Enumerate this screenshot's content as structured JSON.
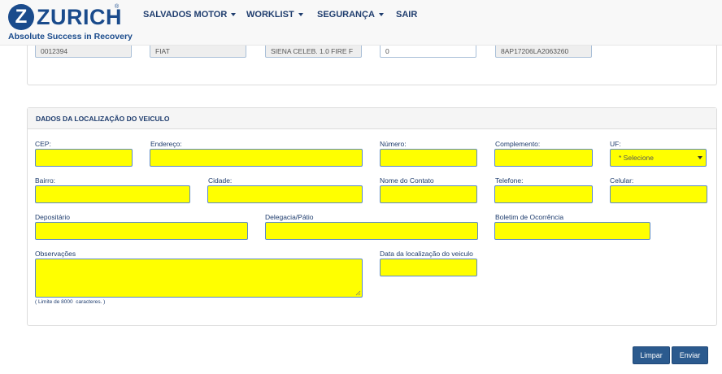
{
  "header": {
    "logo_letter": "Z",
    "brand": "ZURICH",
    "registered": "®",
    "tagline": "Absolute Success in Recovery",
    "nav": [
      {
        "label": "SALVADOS MOTOR"
      },
      {
        "label": "WORKLIST"
      },
      {
        "label": "SEGURANÇA"
      },
      {
        "label": "SAIR"
      }
    ]
  },
  "vehicle_row": {
    "values": [
      "0012394",
      "FIAT",
      "SIENA CELEB. 1.0 FIRE F",
      "0",
      "8AP17206LA2063260"
    ]
  },
  "location": {
    "title": "DADOS DA LOCALIZAÇÃO DO VEICULO",
    "labels": {
      "cep": "CEP:",
      "endereco": "Endereço:",
      "numero": "Número:",
      "complemento": "Complemento:",
      "uf": "UF:",
      "bairro": "Bairro:",
      "cidade": "Cidade:",
      "contato": "Nome do Contato",
      "telefone": "Telefone:",
      "celular": "Celular:",
      "depositario": "Depositário",
      "delegacia": "Delegacia/Pátio",
      "boletim": "Boletim de Ocorrência",
      "observacoes": "Observações",
      "data_localizacao": "Data da localização do veiculo"
    },
    "uf_selected": "* Selecione",
    "limit_note": "( Limite de 8000  caracteres. )"
  },
  "buttons": {
    "limpar": "Limpar",
    "enviar": "Enviar"
  },
  "colors": {
    "brand": "#1a4b8c",
    "field_fill": "#ffff00",
    "button": "#2b5a8e"
  }
}
